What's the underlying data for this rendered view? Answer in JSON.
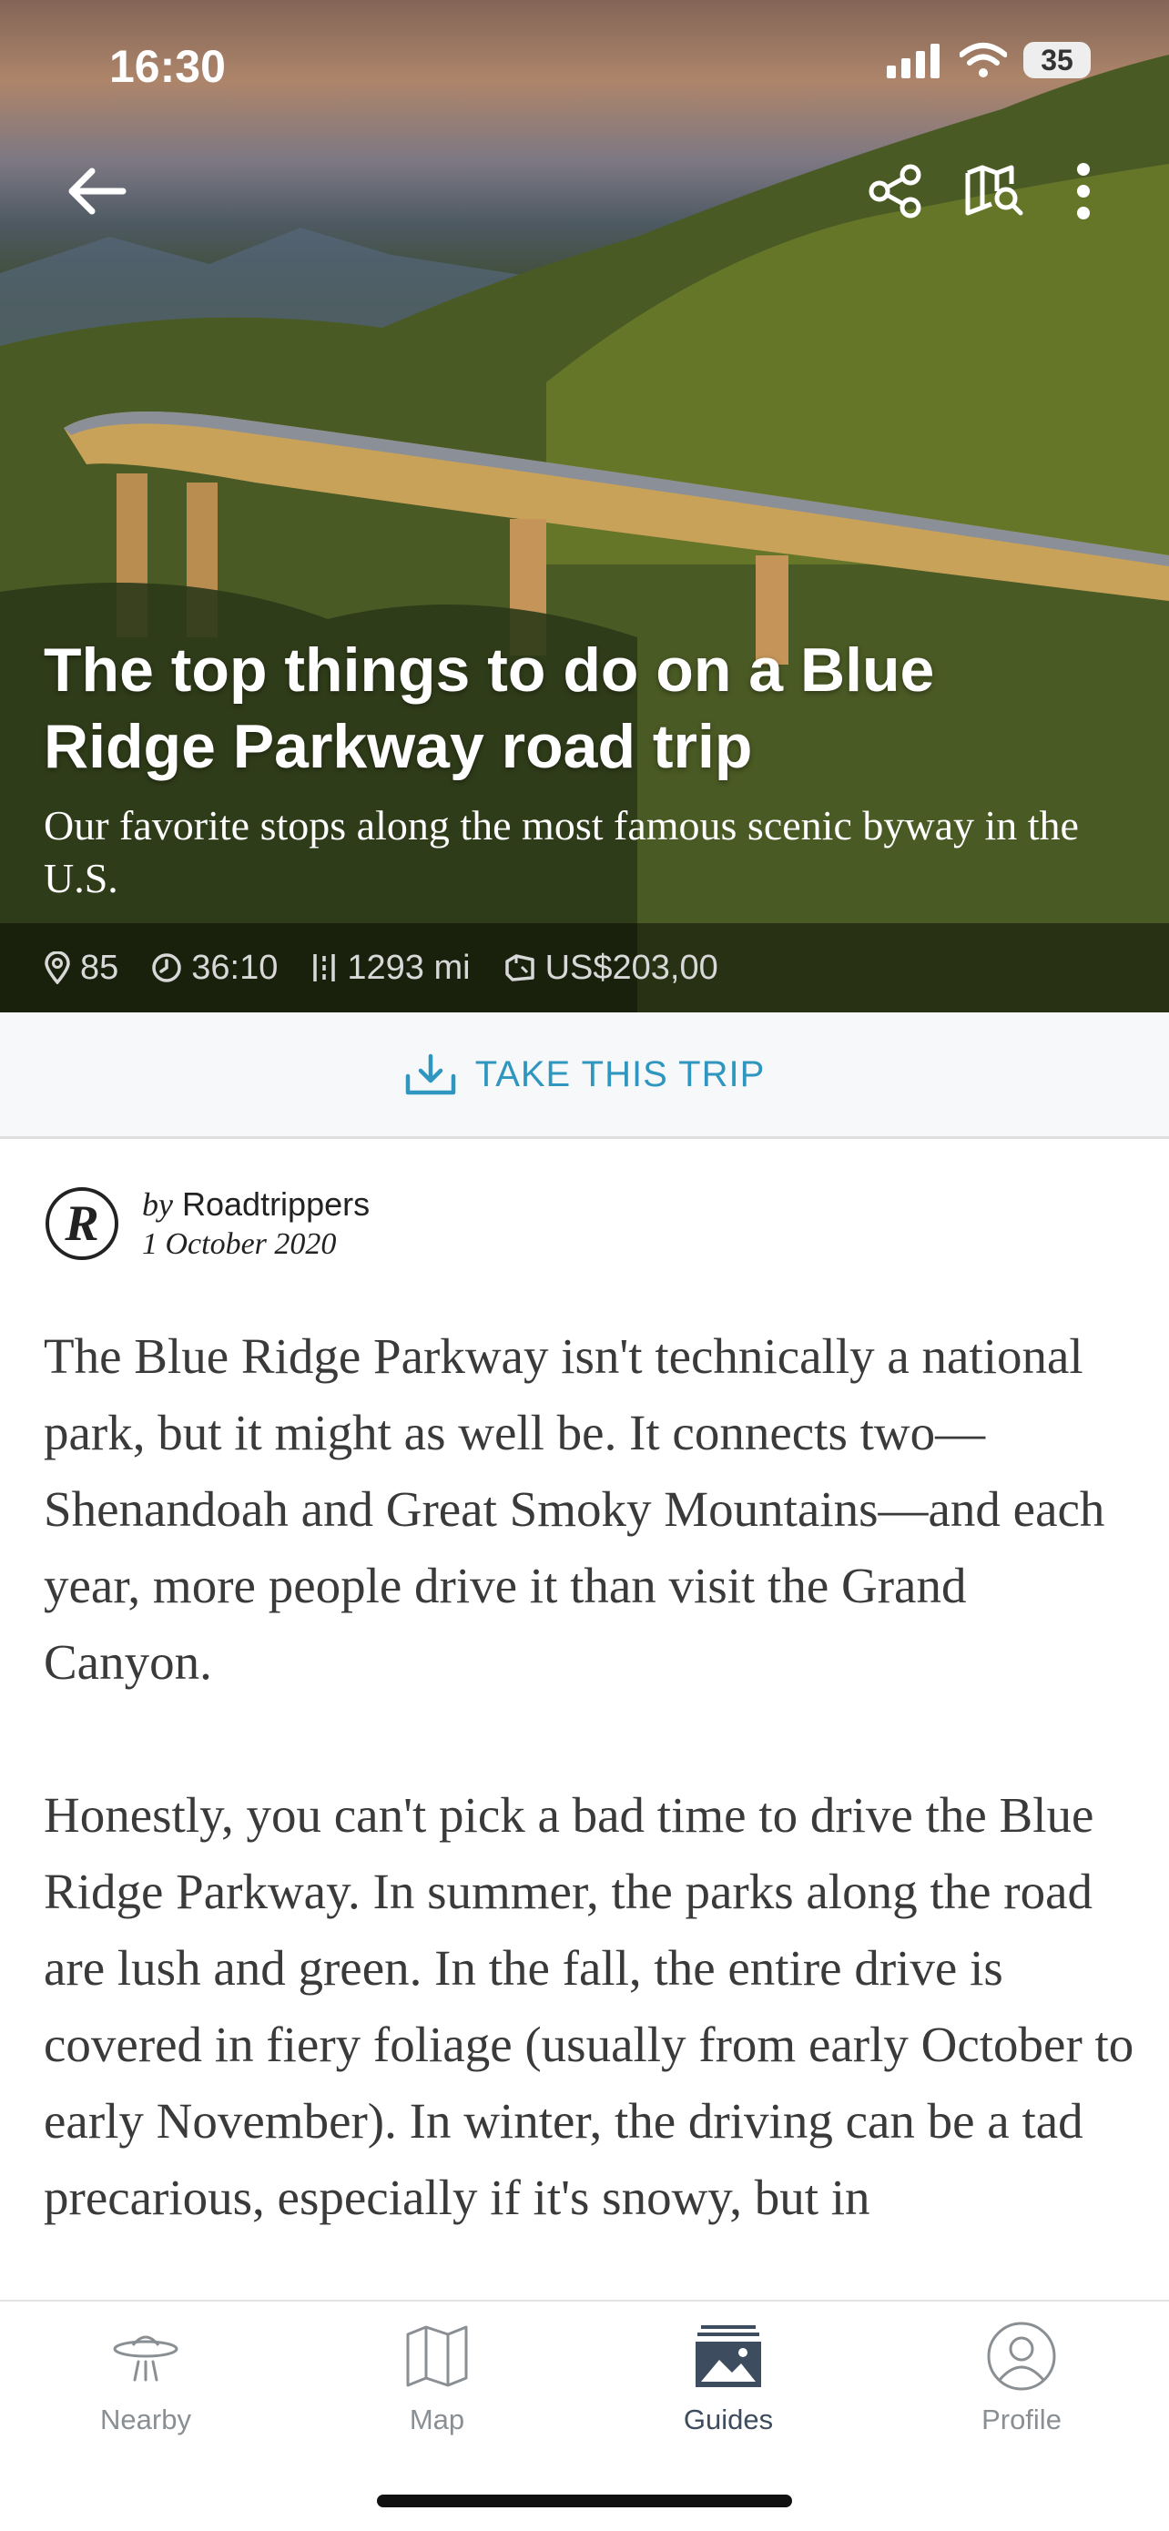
{
  "status_bar": {
    "time": "16:30",
    "battery": "35"
  },
  "hero": {
    "title": "The top things to do on a Blue Ridge Parkway road trip",
    "subtitle": "Our favorite stops along the most famous scenic byway in the U.S.",
    "stats": {
      "places": "85",
      "duration": "36:10",
      "distance": "1293 mi",
      "cost": "US$203,00"
    }
  },
  "actions": {
    "take_trip": "TAKE THIS TRIP"
  },
  "author": {
    "by": "by",
    "name": "Roadtrippers",
    "date": "1 October 2020",
    "logo_letter": "R"
  },
  "article": {
    "paragraphs": [
      "The Blue Ridge Parkway isn't technically a national park, but it might as well be. It connects two—Shenandoah and Great Smoky Mountains—and each year, more people drive it than visit the Grand Canyon.",
      "Honestly, you can't pick a bad time to drive the Blue Ridge Parkway. In summer, the parks along the road are lush and green. In the fall, the entire drive is covered in fiery foliage (usually from early October to early November). In winter, the driving can be a tad precarious, especially if it's snowy, but in"
    ]
  },
  "tabbar": {
    "tabs": [
      {
        "label": "Nearby",
        "icon": "ufo-icon"
      },
      {
        "label": "Map",
        "icon": "map-icon"
      },
      {
        "label": "Guides",
        "icon": "guides-icon",
        "active": true
      },
      {
        "label": "Profile",
        "icon": "profile-icon"
      }
    ]
  },
  "colors": {
    "accent": "#2f96bf",
    "active_tab": "#3d4c5e",
    "inactive_tab": "#8a8f94"
  }
}
